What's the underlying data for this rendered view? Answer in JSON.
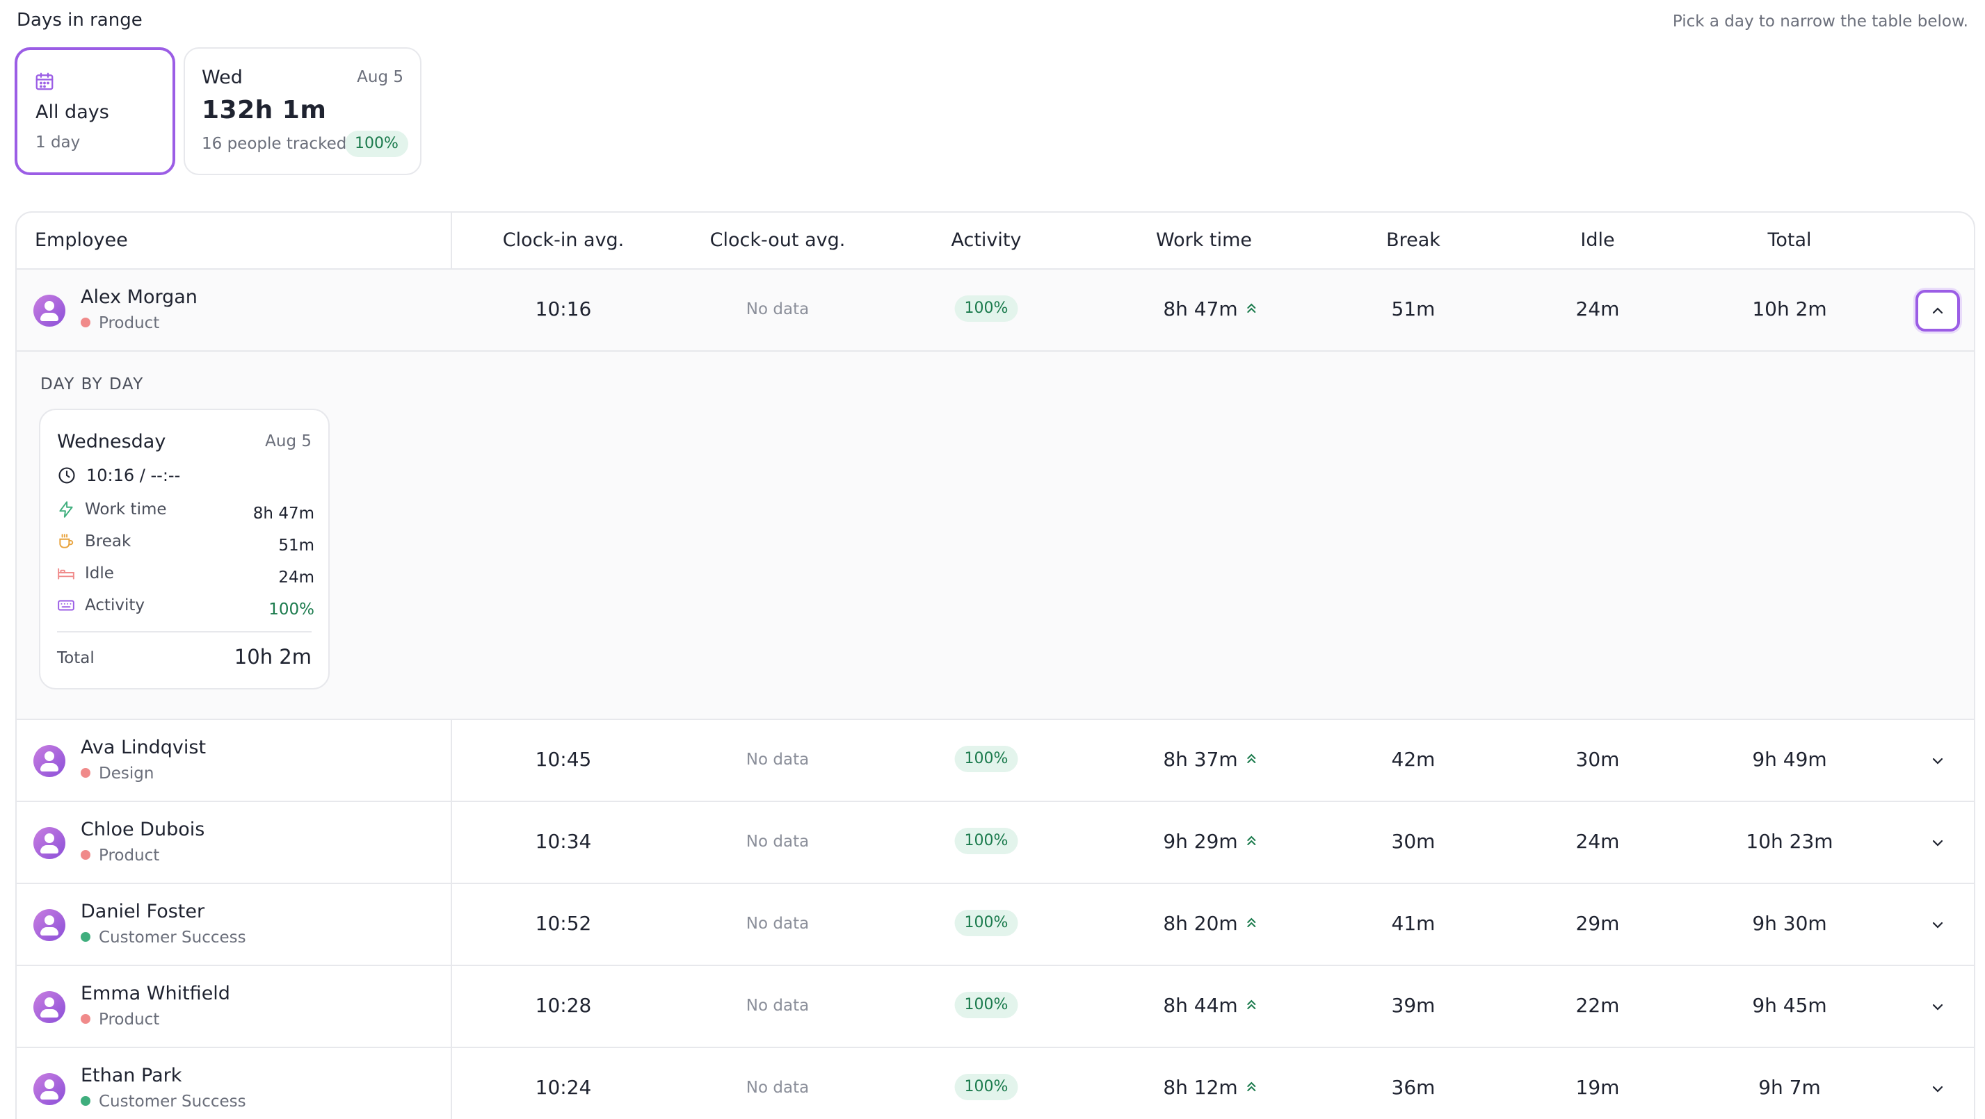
{
  "header": {
    "title": "Days in range",
    "hint": "Pick a day to narrow the table below."
  },
  "day_cards": {
    "all": {
      "label": "All days",
      "sub": "1 day"
    },
    "wed": {
      "day": "Wed",
      "date": "Aug 5",
      "total": "132h 1m",
      "people": "16 people tracked",
      "badge": "100%"
    }
  },
  "table": {
    "headers": {
      "employee": "Employee",
      "clock_in": "Clock-in avg.",
      "clock_out": "Clock-out avg.",
      "activity": "Activity",
      "work_time": "Work time",
      "break": "Break",
      "idle": "Idle",
      "total": "Total"
    },
    "rows": [
      {
        "name": "Alex Morgan",
        "team": "Product",
        "team_color": "#f08a8a",
        "clock_in": "10:16",
        "clock_out": "No data",
        "activity": "100%",
        "work": "8h 47m",
        "break": "51m",
        "idle": "24m",
        "total": "10h 2m"
      },
      {
        "name": "Ava Lindqvist",
        "team": "Design",
        "team_color": "#f08a8a",
        "clock_in": "10:45",
        "clock_out": "No data",
        "activity": "100%",
        "work": "8h 37m",
        "break": "42m",
        "idle": "30m",
        "total": "9h 49m"
      },
      {
        "name": "Chloe Dubois",
        "team": "Product",
        "team_color": "#f08a8a",
        "clock_in": "10:34",
        "clock_out": "No data",
        "activity": "100%",
        "work": "9h 29m",
        "break": "30m",
        "idle": "24m",
        "total": "10h 23m"
      },
      {
        "name": "Daniel Foster",
        "team": "Customer Success",
        "team_color": "#3fae7d",
        "clock_in": "10:52",
        "clock_out": "No data",
        "activity": "100%",
        "work": "8h 20m",
        "break": "41m",
        "idle": "29m",
        "total": "9h 30m"
      },
      {
        "name": "Emma Whitfield",
        "team": "Product",
        "team_color": "#f08a8a",
        "clock_in": "10:28",
        "clock_out": "No data",
        "activity": "100%",
        "work": "8h 44m",
        "break": "39m",
        "idle": "22m",
        "total": "9h 45m"
      },
      {
        "name": "Ethan Park",
        "team": "Customer Success",
        "team_color": "#3fae7d",
        "clock_in": "10:24",
        "clock_out": "No data",
        "activity": "100%",
        "work": "8h 12m",
        "break": "36m",
        "idle": "19m",
        "total": "9h 7m"
      }
    ]
  },
  "details": {
    "title": "DAY BY DAY",
    "card": {
      "day": "Wednesday",
      "date": "Aug 5",
      "clock": "10:16 / --:--",
      "work_label": "Work time",
      "work_value": "8h 47m",
      "break_label": "Break",
      "break_value": "51m",
      "idle_label": "Idle",
      "idle_value": "24m",
      "activity_label": "Activity",
      "activity_value": "100%",
      "total_label": "Total",
      "total_value": "10h 2m"
    }
  },
  "colors": {
    "accent": "#9b5de5",
    "success_bg": "#e3f4ec",
    "success_text": "#1a7a4c",
    "border": "#e7e8ec"
  },
  "icons": {
    "calendar": "calendar-icon",
    "chevron_up": "chevron-up-icon",
    "chevron_down": "chevron-down-icon",
    "trend": "double-chevron-up-icon",
    "clock": "clock-icon",
    "bolt": "bolt-icon",
    "cup": "coffee-cup-icon",
    "bed": "bed-icon",
    "keyboard": "keyboard-icon"
  }
}
